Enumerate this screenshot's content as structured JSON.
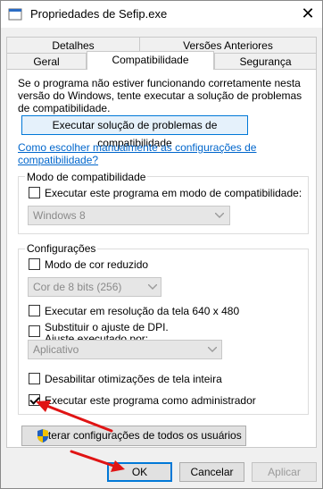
{
  "window": {
    "title": "Propriedades de Sefip.exe",
    "close_glyph": "✕"
  },
  "tabs_row1": [
    "Detalhes",
    "Versões Anteriores"
  ],
  "tabs_row2": [
    "Geral",
    "Compatibilidade",
    "Segurança"
  ],
  "intro_text": "Se o programa não estiver funcionando corretamente nesta versão do Windows, tente executar a solução de problemas de compatibilidade.",
  "troubleshoot_button": "Executar solução de problemas de compatibilidade",
  "help_link": "Como escolher manualmente as configurações de compatibilidade?",
  "compat_group": {
    "legend": "Modo de compatibilidade",
    "checkbox_label": "Executar este programa em modo de compatibilidade:",
    "checked": false,
    "dropdown_value": "Windows 8"
  },
  "settings_group": {
    "legend": "Configurações",
    "reduced_color": {
      "label": "Modo de cor reduzido",
      "checked": false
    },
    "color_dropdown": "Cor de 8 bits (256)",
    "res_640": {
      "label": "Executar em resolução da tela 640 x 480",
      "checked": false
    },
    "dpi_override": {
      "label_line1": "Substituir o ajuste de DPI.",
      "label_line2": "Ajuste executado por:",
      "checked": false
    },
    "dpi_dropdown": "Aplicativo",
    "disable_fullscreen": {
      "label": "Desabilitar otimizações de tela inteira",
      "checked": false
    },
    "run_admin": {
      "label": "Executar este programa como administrador",
      "checked": true
    }
  },
  "change_all_users_button": "Alterar configurações de todos os usuários",
  "buttons": {
    "ok": "OK",
    "cancel": "Cancelar",
    "apply": "Aplicar"
  },
  "icons": [
    "app-icon",
    "close-icon",
    "checkbox-icon",
    "dropdown-arrow-icon",
    "uac-shield-icon",
    "red-arrow-annotation"
  ],
  "colors": {
    "link": "#0066cc",
    "focus_border": "#0078d7",
    "annotation": "#e01414",
    "shield_blue": "#1f5fbf",
    "shield_yellow": "#f2c200"
  }
}
